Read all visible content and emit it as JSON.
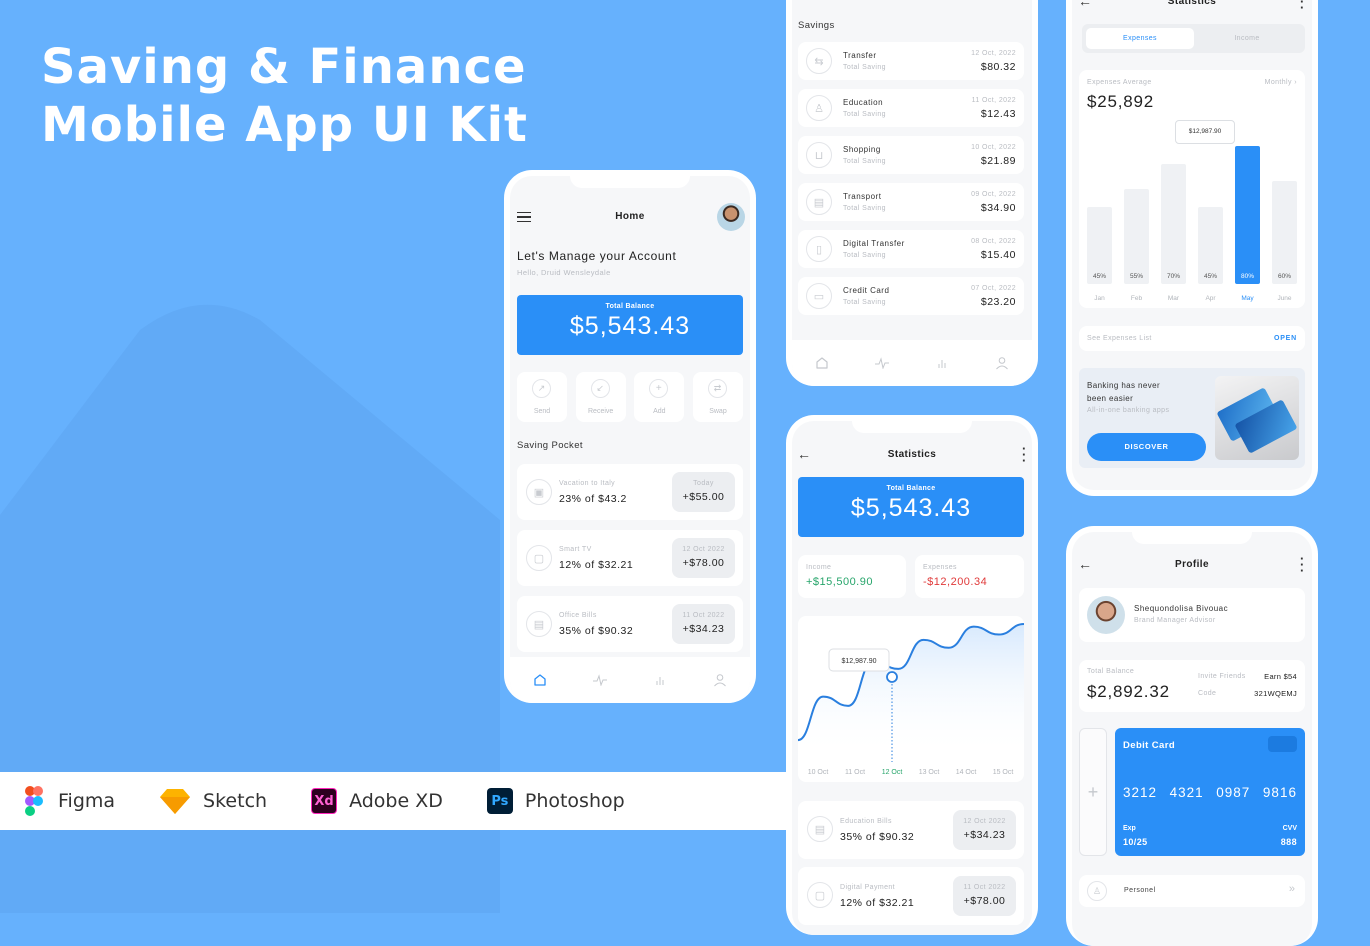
{
  "hero": {
    "title_line1": "Saving & Finance",
    "title_line2": "Mobile App UI Kit"
  },
  "tools": [
    {
      "name": "Figma",
      "icon": "figma-icon"
    },
    {
      "name": "Sketch",
      "icon": "sketch-icon"
    },
    {
      "name": "Adobe XD",
      "icon": "adobe-xd-icon"
    },
    {
      "name": "Photoshop",
      "icon": "photoshop-icon"
    }
  ],
  "colors": {
    "background": "#66b1fd",
    "accent": "#2a8ff7",
    "income": "#27a56b",
    "expense": "#e03a3a"
  },
  "home": {
    "title": "Home",
    "heading": "Let's Manage your Account",
    "greeting": "Hello, Druid Wensleydale",
    "balance_label": "Total Balance",
    "balance": "$5,543.43",
    "actions": [
      "Send",
      "Receive",
      "Add",
      "Swap"
    ],
    "section": "Saving Pocket",
    "pockets": [
      {
        "name": "Vacation to Italy",
        "progress": "23% of $43.2",
        "date": "Today",
        "amount": "+$55.00"
      },
      {
        "name": "Smart TV",
        "progress": "12% of $32.21",
        "date": "12 Oct 2022",
        "amount": "+$78.00"
      },
      {
        "name": "Office Bills",
        "progress": "35% of $90.32",
        "date": "11 Oct 2022",
        "amount": "+$34.23"
      }
    ]
  },
  "savings": {
    "section": "Savings",
    "items": [
      {
        "name": "Transfer",
        "sub": "Total Saving",
        "date": "12 Oct, 2022",
        "amount": "$80.32"
      },
      {
        "name": "Education",
        "sub": "Total Saving",
        "date": "11 Oct, 2022",
        "amount": "$12.43"
      },
      {
        "name": "Shopping",
        "sub": "Total Saving",
        "date": "10 Oct, 2022",
        "amount": "$21.89"
      },
      {
        "name": "Transport",
        "sub": "Total Saving",
        "date": "09 Oct, 2022",
        "amount": "$34.90"
      },
      {
        "name": "Digital Transfer",
        "sub": "Total Saving",
        "date": "08 Oct, 2022",
        "amount": "$15.40"
      },
      {
        "name": "Credit Card",
        "sub": "Total Saving",
        "date": "07 Oct, 2022",
        "amount": "$23.20"
      }
    ]
  },
  "statistics": {
    "title": "Statistics",
    "balance_label": "Total Balance",
    "balance": "$5,543.43",
    "income_label": "Income",
    "income": "+$15,500.90",
    "expenses_label": "Expenses",
    "expenses": "-$12,200.34",
    "tooltip": "$12,987.90",
    "bills": [
      {
        "name": "Education Bills",
        "progress": "35% of $90.32",
        "date": "12 Oct 2022",
        "amount": "+$34.23"
      },
      {
        "name": "Digital Payment",
        "progress": "12% of $32.21",
        "date": "11 Oct 2022",
        "amount": "+$78.00"
      }
    ]
  },
  "expenses_stats": {
    "title": "Statistics",
    "tabs": [
      "Expenses",
      "Income"
    ],
    "average_label": "Expenses Average",
    "period": "Monthly",
    "average": "$25,892",
    "tooltip": "$12,987.90",
    "list_label": "See Expenses List",
    "open": "OPEN",
    "promo_title": "Banking has never been easier",
    "promo_sub": "All-in-one banking apps",
    "promo_button": "DISCOVER"
  },
  "profile": {
    "title": "Profile",
    "name": "Shequondolisa Bivouac",
    "role": "Brand Manager Advisor",
    "balance_label": "Total Balance",
    "balance": "$2,892.32",
    "invite_label": "Invite Friends",
    "invite_value": "Earn $54",
    "code_label": "Code",
    "code": "321WQEMJ",
    "card_title": "Debit Card",
    "card_number": [
      "3212",
      "4321",
      "0987",
      "9816"
    ],
    "exp_label": "Exp",
    "exp": "10/25",
    "cvv_label": "CVV",
    "cvv": "888",
    "menu_item": "Personel"
  },
  "chart_data": [
    {
      "type": "line",
      "title": "Statistics",
      "x": [
        "10 Oct",
        "11 Oct",
        "12 Oct",
        "13 Oct",
        "14 Oct",
        "15 Oct"
      ],
      "highlight": {
        "x": "12 Oct",
        "label": "$12,987.90"
      },
      "series": [
        {
          "name": "Balance",
          "values": [
            0.12,
            0.45,
            0.38,
            0.72,
            0.66,
            0.88,
            0.82,
            0.98,
            0.92,
            1.0
          ]
        }
      ],
      "xlabel": "",
      "ylabel": "",
      "grid": false
    },
    {
      "type": "bar",
      "title": "Expenses Average",
      "categories": [
        "Jan",
        "Feb",
        "Mar",
        "Apr",
        "May",
        "June"
      ],
      "values": [
        45,
        55,
        70,
        45,
        80,
        60
      ],
      "labels": [
        "45%",
        "55%",
        "70%",
        "45%",
        "80%",
        "60%"
      ],
      "highlight": "May",
      "tooltip": "$12,987.90",
      "ylim": [
        0,
        100
      ]
    }
  ]
}
